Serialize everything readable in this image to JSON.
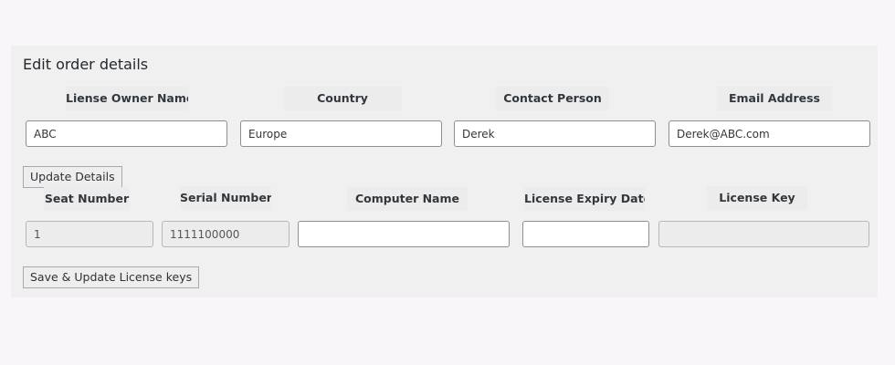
{
  "form": {
    "title": "Edit order details",
    "order_labels": {
      "owner": "Liense Owner Name",
      "country": "Country",
      "contact": "Contact Person",
      "email": "Email Address"
    },
    "order_values": {
      "owner": "ABC",
      "country": "Europe",
      "contact": "Derek",
      "email": "Derek@ABC.com"
    },
    "update_button_label": "Update Details",
    "license_labels": {
      "seat": "Seat Number",
      "serial": "Serial Number",
      "computer": "Computer Name",
      "expiry": "License Expiry Date",
      "key": "License Key"
    },
    "license_values": {
      "seat": "1",
      "serial": "1111100000",
      "computer": "",
      "expiry": "",
      "key": ""
    },
    "save_button_label": "Save & Update License keys"
  }
}
